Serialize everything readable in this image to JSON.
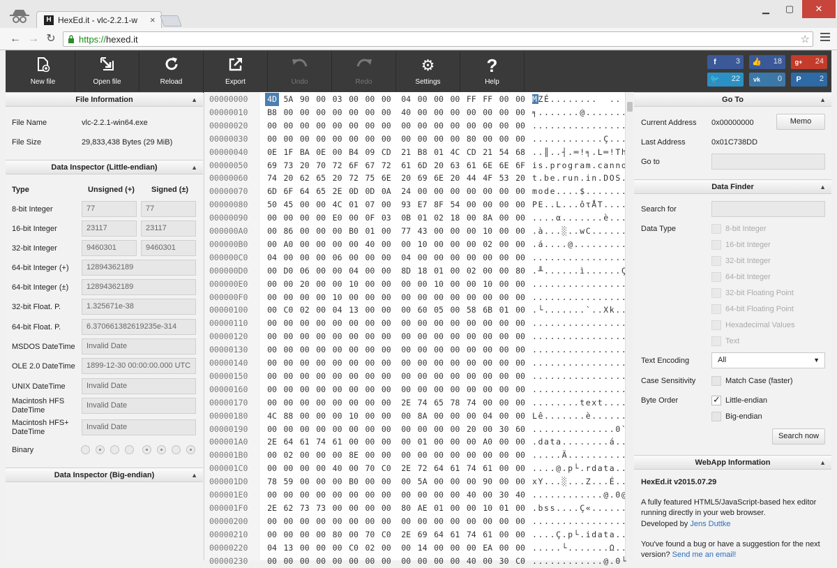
{
  "browser": {
    "tab_title": "vlc-2.2.1-w",
    "tab_prefix": "HexEd.it - ",
    "url_scheme": "https://",
    "url_host": "hexed.it"
  },
  "toolbar": {
    "buttons": [
      {
        "label": "New file",
        "icon": "new-file-icon"
      },
      {
        "label": "Open file",
        "icon": "open-file-icon"
      },
      {
        "label": "Reload",
        "icon": "reload-icon"
      },
      {
        "label": "Export",
        "icon": "export-icon"
      },
      {
        "label": "Undo",
        "icon": "undo-icon"
      },
      {
        "label": "Redo",
        "icon": "redo-icon"
      },
      {
        "label": "Settings",
        "icon": "gear-icon"
      },
      {
        "label": "Help",
        "icon": "help-icon"
      }
    ],
    "social": [
      {
        "name": "facebook",
        "count": "3",
        "color": "#3b5998"
      },
      {
        "name": "like",
        "count": "18",
        "color": "#3b5998"
      },
      {
        "name": "google-plus",
        "count": "24",
        "color": "#c33b2b"
      },
      {
        "name": "twitter",
        "count": "22",
        "color": "#2b91c4"
      },
      {
        "name": "vk",
        "count": "0",
        "color": "#3b78a8"
      },
      {
        "name": "paypal",
        "count": "2",
        "color": "#2d6aa6"
      }
    ]
  },
  "file_info": {
    "header": "File Information",
    "name_label": "File Name",
    "name_value": "vlc-2.2.1-win64.exe",
    "size_label": "File Size",
    "size_value": "29,833,438 Bytes (29 MiB)"
  },
  "inspector_le": {
    "header": "Data Inspector (Little-endian)",
    "col_type": "Type",
    "col_unsigned": "Unsigned (+)",
    "col_signed": "Signed (±)",
    "rows": [
      {
        "label": "8-bit Integer",
        "unsigned": "77",
        "signed": "77"
      },
      {
        "label": "16-bit Integer",
        "unsigned": "23117",
        "signed": "23117"
      },
      {
        "label": "32-bit Integer",
        "unsigned": "9460301",
        "signed": "9460301"
      },
      {
        "label": "64-bit Integer (+)",
        "value": "12894362189"
      },
      {
        "label": "64-bit Integer (±)",
        "value": "12894362189"
      },
      {
        "label": "32-bit Float. P.",
        "value": "1.325671e-38"
      },
      {
        "label": "64-bit Float. P.",
        "value": "6.370661382619235e-314"
      },
      {
        "label": "MSDOS DateTime",
        "value": "Invalid Date"
      },
      {
        "label": "OLE 2.0 DateTime",
        "value": "1899-12-30 00:00:00.000 UTC"
      },
      {
        "label": "UNIX DateTime",
        "value": "Invalid Date"
      },
      {
        "label": "Macintosh HFS DateTime",
        "value": "Invalid Date"
      },
      {
        "label": "Macintosh HFS+ DateTime",
        "value": "Invalid Date"
      }
    ],
    "binary_label": "Binary",
    "binary_bits": [
      0,
      1,
      0,
      0,
      1,
      1,
      0,
      1
    ]
  },
  "inspector_be": {
    "header": "Data Inspector (Big-endian)"
  },
  "hex": {
    "rows": [
      {
        "addr": "00000000",
        "bytes": "4D 5A 90 00 03 00 00 00 04 00 00 00 FF FF 00 00",
        "text": "MZÉ........  .."
      },
      {
        "addr": "00000010",
        "bytes": "B8 00 00 00 00 00 00 00 40 00 00 00 00 00 00 00",
        "text": "╕.......@......."
      },
      {
        "addr": "00000020",
        "bytes": "00 00 00 00 00 00 00 00 00 00 00 00 00 00 00 00",
        "text": "................"
      },
      {
        "addr": "00000030",
        "bytes": "00 00 00 00 00 00 00 00 00 00 00 00 80 00 00 00",
        "text": "............Ç..."
      },
      {
        "addr": "00000040",
        "bytes": "0E 1F BA 0E 00 B4 09 CD 21 B8 01 4C CD 21 54 68",
        "text": "..║..┤.═!╕.L═!Th"
      },
      {
        "addr": "00000050",
        "bytes": "69 73 20 70 72 6F 67 72 61 6D 20 63 61 6E 6E 6F",
        "text": "is.program.canno"
      },
      {
        "addr": "00000060",
        "bytes": "74 20 62 65 20 72 75 6E 20 69 6E 20 44 4F 53 20",
        "text": "t.be.run.in.DOS."
      },
      {
        "addr": "00000070",
        "bytes": "6D 6F 64 65 2E 0D 0D 0A 24 00 00 00 00 00 00 00",
        "text": "mode....$......."
      },
      {
        "addr": "00000080",
        "bytes": "50 45 00 00 4C 01 07 00 93 E7 8F 54 00 00 00 00",
        "text": "PE..L...ôτÅT...."
      },
      {
        "addr": "00000090",
        "bytes": "00 00 00 00 E0 00 0F 03 0B 01 02 18 00 8A 00 00",
        "text": "....α.......è..."
      },
      {
        "addr": "000000A0",
        "bytes": "00 86 00 00 00 B0 01 00 77 43 00 00 00 10 00 00",
        "text": ".à...░..wC......"
      },
      {
        "addr": "000000B0",
        "bytes": "00 A0 00 00 00 00 40 00 00 10 00 00 00 02 00 00",
        "text": ".á....@........."
      },
      {
        "addr": "000000C0",
        "bytes": "04 00 00 00 06 00 00 00 04 00 00 00 00 00 00 00",
        "text": "................"
      },
      {
        "addr": "000000D0",
        "bytes": "00 D0 06 00 00 04 00 00 8D 18 01 00 02 00 00 80",
        "text": ".╨......ì......Ç"
      },
      {
        "addr": "000000E0",
        "bytes": "00 00 20 00 00 10 00 00 00 00 10 00 00 10 00 00",
        "text": "................"
      },
      {
        "addr": "000000F0",
        "bytes": "00 00 00 00 10 00 00 00 00 00 00 00 00 00 00 00",
        "text": "................"
      },
      {
        "addr": "00000100",
        "bytes": "00 C0 02 00 04 13 00 00 00 60 05 00 58 6B 01 00",
        "text": ".└.......`..Xk.."
      },
      {
        "addr": "00000110",
        "bytes": "00 00 00 00 00 00 00 00 00 00 00 00 00 00 00 00",
        "text": "................"
      },
      {
        "addr": "00000120",
        "bytes": "00 00 00 00 00 00 00 00 00 00 00 00 00 00 00 00",
        "text": "................"
      },
      {
        "addr": "00000130",
        "bytes": "00 00 00 00 00 00 00 00 00 00 00 00 00 00 00 00",
        "text": "................"
      },
      {
        "addr": "00000140",
        "bytes": "00 00 00 00 00 00 00 00 00 00 00 00 00 00 00 00",
        "text": "................"
      },
      {
        "addr": "00000150",
        "bytes": "00 00 00 00 00 00 00 00 00 00 00 00 00 00 00 00",
        "text": "................"
      },
      {
        "addr": "00000160",
        "bytes": "00 00 00 00 00 00 00 00 00 00 00 00 00 00 00 00",
        "text": "................"
      },
      {
        "addr": "00000170",
        "bytes": "00 00 00 00 00 00 00 00 2E 74 65 78 74 00 00 00",
        "text": "........text...."
      },
      {
        "addr": "00000180",
        "bytes": "4C 88 00 00 00 10 00 00 00 8A 00 00 00 04 00 00",
        "text": "Lê.......è......"
      },
      {
        "addr": "00000190",
        "bytes": "00 00 00 00 00 00 00 00 00 00 00 00 20 00 30 60",
        "text": "..............0`"
      },
      {
        "addr": "000001A0",
        "bytes": "2E 64 61 74 61 00 00 00 00 01 00 00 00 A0 00 00",
        "text": ".data........á.."
      },
      {
        "addr": "000001B0",
        "bytes": "00 02 00 00 00 8E 00 00 00 00 00 00 00 00 00 00",
        "text": ".....Ä.........."
      },
      {
        "addr": "000001C0",
        "bytes": "00 00 00 00 40 00 70 C0 2E 72 64 61 74 61 00 00",
        "text": "....@.p└.rdata.."
      },
      {
        "addr": "000001D0",
        "bytes": "78 59 00 00 00 B0 00 00 00 5A 00 00 00 90 00 00",
        "text": "xY...░...Z...É.."
      },
      {
        "addr": "000001E0",
        "bytes": "00 00 00 00 00 00 00 00 00 00 00 00 40 00 30 40",
        "text": "............@.0@"
      },
      {
        "addr": "000001F0",
        "bytes": "2E 62 73 73 00 00 00 00 80 AE 01 00 00 10 01 00",
        "text": ".bss....Ç«......"
      },
      {
        "addr": "00000200",
        "bytes": "00 00 00 00 00 00 00 00 00 00 00 00 00 00 00 00",
        "text": "................"
      },
      {
        "addr": "00000210",
        "bytes": "00 00 00 00 80 00 70 C0 2E 69 64 61 74 61 00 00",
        "text": "....Ç.p└.idata.."
      },
      {
        "addr": "00000220",
        "bytes": "04 13 00 00 00 C0 02 00 00 14 00 00 00 EA 00 00",
        "text": ".....└.......Ω.."
      },
      {
        "addr": "00000230",
        "bytes": "00 00 00 00 00 00 00 00 00 00 00 00 40 00 30 C0",
        "text": "............@.0└"
      }
    ]
  },
  "goto": {
    "header": "Go To",
    "current_label": "Current Address",
    "current_value": "0x00000000",
    "memo_label": "Memo",
    "last_label": "Last Address",
    "last_value": "0x01C738DD",
    "goto_label": "Go to",
    "goto_value": ""
  },
  "finder": {
    "header": "Data Finder",
    "search_label": "Search for",
    "search_value": "",
    "type_label": "Data Type",
    "types": [
      "8-bit Integer",
      "16-bit Integer",
      "32-bit Integer",
      "64-bit Integer",
      "32-bit Floating Point",
      "64-bit Floating Point",
      "Hexadecimal Values",
      "Text"
    ],
    "encoding_label": "Text Encoding",
    "encoding_value": "All",
    "case_label": "Case Sensitivity",
    "case_option": "Match Case (faster)",
    "order_label": "Byte Order",
    "order_le": "Little-endian",
    "order_be": "Big-endian",
    "search_button": "Search now"
  },
  "webapp": {
    "header": "WebApp Information",
    "version": "HexEd.it v2015.07.29",
    "desc": "A fully featured HTML5/JavaScript-based hex editor running directly in your web browser.",
    "dev_prefix": "Developed by ",
    "dev_name": "Jens Duttke",
    "bug_text": "You've found a bug or have a suggestion for the next version? ",
    "bug_link": "Send me an email!"
  }
}
